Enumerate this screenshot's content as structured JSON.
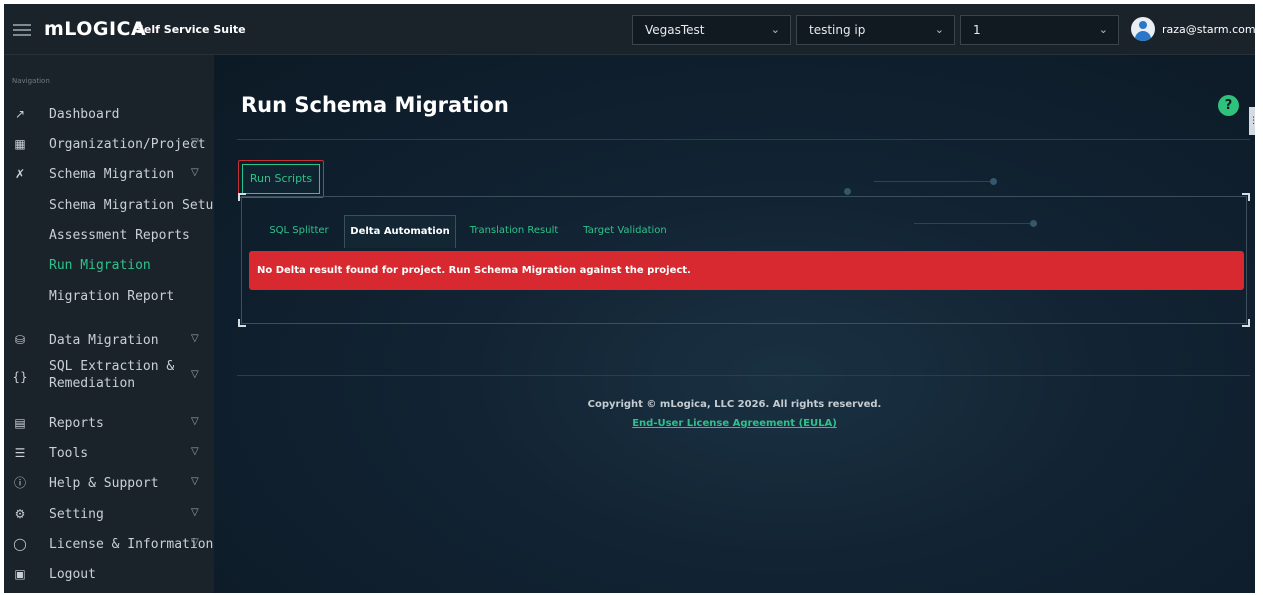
{
  "header": {
    "brand": "mLOGICA",
    "suite_name": "Self Service Suite",
    "selects": [
      {
        "value": "VegasTest"
      },
      {
        "value": "testing ip"
      },
      {
        "value": "1"
      }
    ],
    "user_email": "raza@starm.com"
  },
  "sidebar": {
    "heading": "Navigation",
    "items": [
      {
        "label": "Dashboard",
        "icon": "chart-line-icon"
      },
      {
        "label": "Organization/Project",
        "icon": "grid-icon",
        "expandable": true
      },
      {
        "label": "Schema Migration",
        "icon": "tools-icon",
        "expandable": true
      },
      {
        "label": "Schema Migration Setup",
        "sub": true
      },
      {
        "label": "Assessment Reports",
        "sub": true
      },
      {
        "label": "Run Migration",
        "sub": true,
        "active": true
      },
      {
        "label": "Migration Report",
        "sub": true
      },
      {
        "label": "Data Migration",
        "icon": "database-icon",
        "expandable": true
      },
      {
        "label": "SQL Extraction &",
        "label2": "Remediation",
        "icon": "braces-icon",
        "expandable": true
      },
      {
        "label": "Reports",
        "icon": "report-icon",
        "expandable": true
      },
      {
        "label": "Tools",
        "icon": "layers-icon",
        "expandable": true
      },
      {
        "label": "Help & Support",
        "icon": "help-circle-icon",
        "expandable": true
      },
      {
        "label": "Setting",
        "icon": "gear-icon",
        "expandable": true
      },
      {
        "label": "License & Information",
        "icon": "shield-icon",
        "expandable": true
      },
      {
        "label": "Logout",
        "icon": "logout-icon"
      }
    ]
  },
  "main": {
    "title": "Run Schema Migration",
    "run_scripts_label": "Run Scripts",
    "tabs": [
      {
        "label": "SQL Splitter",
        "active": false
      },
      {
        "label": "Delta Automation",
        "active": true
      },
      {
        "label": "Translation Result",
        "active": false
      },
      {
        "label": "Target Validation",
        "active": false
      }
    ],
    "alert_message": "No Delta result found for project. Run Schema Migration against the project."
  },
  "footer": {
    "copyright": "Copyright © mLogica, LLC 2026. All rights reserved.",
    "eula_link": "End-User License Agreement (EULA)"
  },
  "colors": {
    "accent_green": "#2ec28a",
    "alert_red": "#d7292f",
    "background": "#0d1b26",
    "sidebar": "#1b232a"
  }
}
